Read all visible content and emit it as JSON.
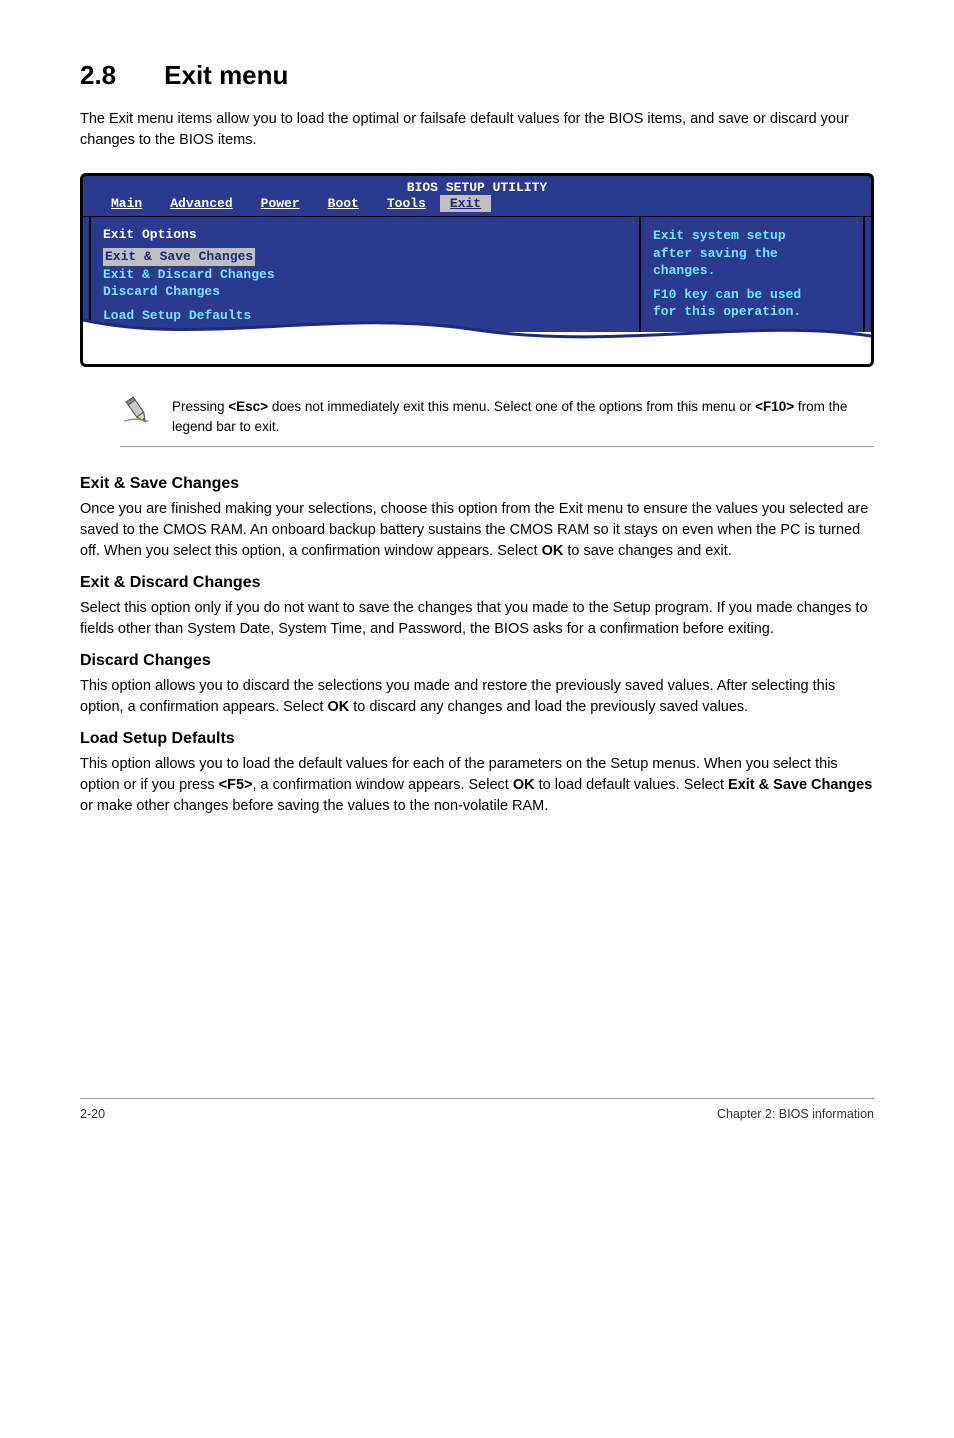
{
  "section": {
    "number": "2.8",
    "title": "Exit menu"
  },
  "intro": "The Exit menu items allow you to load the optimal or failsafe default values for the BIOS items, and save or discard your changes to the BIOS items.",
  "bios": {
    "utility_title": "BIOS SETUP UTILITY",
    "tabs": [
      "Main",
      "Advanced",
      "Power",
      "Boot",
      "Tools",
      "Exit"
    ],
    "active_tab": "Exit",
    "left": {
      "heading": "Exit Options",
      "items": [
        "Exit & Save Changes",
        "Exit & Discard Changes",
        "Discard Changes",
        "Load Setup Defaults"
      ],
      "selected_index": 0
    },
    "help": {
      "line1": "Exit system setup",
      "line2": "after saving the",
      "line3": "changes.",
      "line4": "F10 key can be used",
      "line5": "for this operation."
    }
  },
  "note": {
    "text_a": "Pressing ",
    "key1": "<Esc>",
    "text_b": " does not immediately exit this menu. Select one of the options from this menu or ",
    "key2": "<F10>",
    "text_c": " from the legend bar to exit."
  },
  "subsections": {
    "s1": {
      "title": "Exit & Save Changes",
      "body_a": "Once you are finished making your selections, choose this option from the Exit menu to ensure the values you selected are saved to the CMOS RAM. An onboard backup battery sustains the CMOS RAM so it stays on even when the PC is turned off. When you select this option, a confirmation window appears. Select ",
      "ok": "OK",
      "body_b": " to save changes and exit."
    },
    "s2": {
      "title": "Exit & Discard Changes",
      "body": "Select this option only if you do not want to save the changes that you made to the Setup program. If you made changes to fields other than System Date, System Time, and Password, the BIOS asks for a confirmation before exiting."
    },
    "s3": {
      "title": "Discard Changes",
      "body_a": "This option allows you to discard the selections you made and restore the previously saved values. After selecting this option, a confirmation appears. Select ",
      "ok": "OK",
      "body_b": " to discard any changes and load the previously saved values."
    },
    "s4": {
      "title": "Load Setup Defaults",
      "body_a": "This option allows you to load the default values for each of the parameters on the Setup menus. When you select this option or if you press ",
      "key": "<F5>",
      "body_b": ", a confirmation window appears. Select ",
      "ok": "OK",
      "body_c": " to load default values. Select ",
      "exitsave": "Exit & Save Changes",
      "body_d": " or make other changes before saving the values to the non-volatile RAM."
    }
  },
  "footer": {
    "left": "2-20",
    "right": "Chapter 2: BIOS information"
  }
}
